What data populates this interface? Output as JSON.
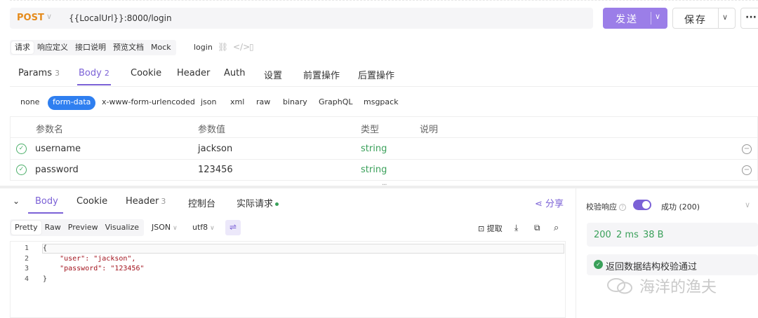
{
  "request": {
    "method": "POST",
    "url": "{{LocalUrl}}:8000/login",
    "send_label": "发送",
    "save_label": "保存",
    "more_label": "···"
  },
  "subtabs": [
    "请求",
    "响应定义",
    "接口说明",
    "预览文档",
    "Mock"
  ],
  "api_name": "login",
  "param_tabs": [
    {
      "label": "Params",
      "count": "3"
    },
    {
      "label": "Body",
      "count": "2"
    },
    {
      "label": "Cookie",
      "count": ""
    },
    {
      "label": "Header",
      "count": ""
    },
    {
      "label": "Auth",
      "count": ""
    },
    {
      "label": "设置",
      "count": ""
    },
    {
      "label": "前置操作",
      "count": ""
    },
    {
      "label": "后置操作",
      "count": ""
    }
  ],
  "body_types": [
    "none",
    "form-data",
    "x-www-form-urlencoded",
    "json",
    "xml",
    "raw",
    "binary",
    "GraphQL",
    "msgpack"
  ],
  "table": {
    "headers": [
      "参数名",
      "参数值",
      "类型",
      "说明"
    ],
    "rows": [
      {
        "name": "username",
        "value": "jackson",
        "type": "string"
      },
      {
        "name": "password",
        "value": "123456",
        "type": "string"
      }
    ]
  },
  "response": {
    "tabs": [
      {
        "label": "Body",
        "count": ""
      },
      {
        "label": "Cookie",
        "count": ""
      },
      {
        "label": "Header",
        "count": "3"
      },
      {
        "label": "控制台",
        "count": ""
      },
      {
        "label": "实际请求",
        "count": ""
      }
    ],
    "share_label": "分享",
    "view_modes": [
      "Pretty",
      "Raw",
      "Preview",
      "Visualize"
    ],
    "format": "JSON",
    "encoding": "utf8",
    "extract_label": "提取",
    "code_lines": [
      "{",
      "    \"user\": \"jackson\",",
      "    \"password\": \"123456\"",
      "}"
    ],
    "line_numbers": [
      "1",
      "2",
      "3",
      "4"
    ]
  },
  "validation": {
    "label": "校验响应",
    "status": "成功 (200)",
    "status_code": "200",
    "time": "2 ms",
    "size": "38 B",
    "message": "返回数据结构校验通过"
  },
  "watermark": "海洋的渔夫",
  "colors": {
    "accent": "#7b61d6",
    "method": "#e58b1c",
    "success": "#3aa05a",
    "active_pill": "#2f7ff0"
  }
}
